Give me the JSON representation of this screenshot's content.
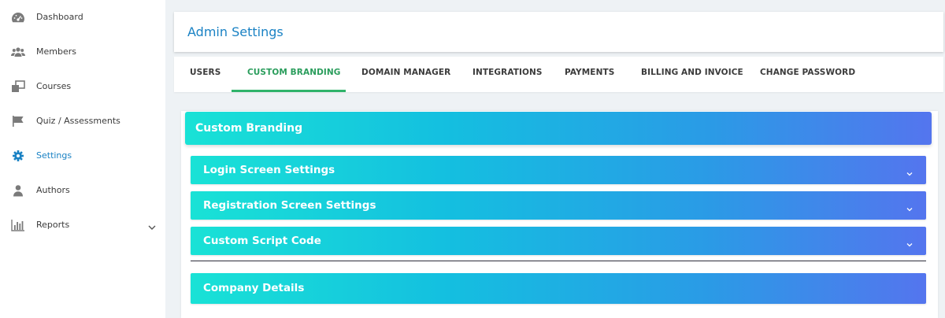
{
  "sidebar": {
    "items": [
      {
        "label": "Dashboard",
        "icon": "dashboard-icon"
      },
      {
        "label": "Members",
        "icon": "members-icon"
      },
      {
        "label": "Courses",
        "icon": "courses-icon"
      },
      {
        "label": "Quiz / Assessments",
        "icon": "flag-icon"
      },
      {
        "label": "Settings",
        "icon": "gear-icon",
        "active": true
      },
      {
        "label": "Authors",
        "icon": "user-icon"
      },
      {
        "label": "Reports",
        "icon": "bar-chart-icon"
      }
    ]
  },
  "header": {
    "title": "Admin Settings"
  },
  "tabs": [
    {
      "label": "USERS"
    },
    {
      "label": "CUSTOM BRANDING",
      "active": true
    },
    {
      "label": "DOMAIN MANAGER"
    },
    {
      "label": "INTEGRATIONS"
    },
    {
      "label": "PAYMENTS"
    },
    {
      "label": "BILLING AND INVOICE"
    },
    {
      "label": "CHANGE PASSWORD"
    }
  ],
  "content": {
    "section_title": "Custom Branding",
    "accordions": [
      {
        "label": "Login Screen Settings"
      },
      {
        "label": "Registration Screen Settings"
      },
      {
        "label": "Custom Script Code"
      },
      {
        "label": "Company Details"
      }
    ]
  },
  "colors": {
    "accent_blue": "#1a82c4",
    "active_tab_green": "#2fb36a",
    "gradient_start": "#19e2d6",
    "gradient_end": "#5475ee"
  }
}
